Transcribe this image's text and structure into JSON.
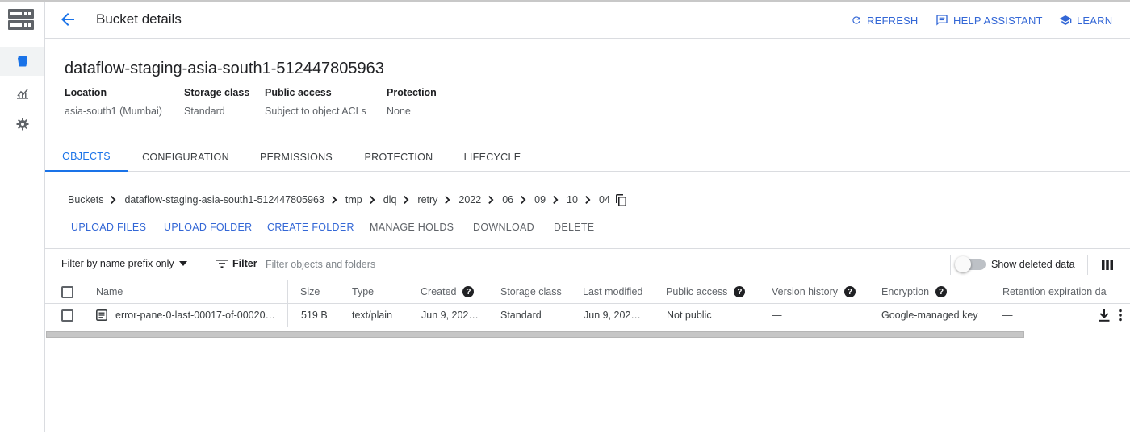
{
  "header": {
    "title": "Bucket details",
    "refresh": "REFRESH",
    "help_assistant": "HELP ASSISTANT",
    "learn": "LEARN"
  },
  "bucket": {
    "name": "dataflow-staging-asia-south1-512447805963",
    "meta": [
      {
        "label": "Location",
        "value": "asia-south1 (Mumbai)"
      },
      {
        "label": "Storage class",
        "value": "Standard"
      },
      {
        "label": "Public access",
        "value": "Subject to object ACLs"
      },
      {
        "label": "Protection",
        "value": "None"
      }
    ]
  },
  "tabs": [
    "OBJECTS",
    "CONFIGURATION",
    "PERMISSIONS",
    "PROTECTION",
    "LIFECYCLE"
  ],
  "active_tab": "OBJECTS",
  "breadcrumb": [
    "Buckets",
    "dataflow-staging-asia-south1-512447805963",
    "tmp",
    "dlq",
    "retry",
    "2022",
    "06",
    "09",
    "10",
    "04"
  ],
  "actions": [
    {
      "label": "UPLOAD FILES",
      "enabled": true
    },
    {
      "label": "UPLOAD FOLDER",
      "enabled": true
    },
    {
      "label": "CREATE FOLDER",
      "enabled": true
    },
    {
      "label": "MANAGE HOLDS",
      "enabled": false
    },
    {
      "label": "DOWNLOAD",
      "enabled": false
    },
    {
      "label": "DELETE",
      "enabled": false
    }
  ],
  "filter": {
    "select_label": "Filter by name prefix only",
    "filter_label": "Filter",
    "placeholder": "Filter objects and folders",
    "show_deleted_label": "Show deleted data",
    "show_deleted_on": false
  },
  "table": {
    "columns": [
      "Name",
      "Size",
      "Type",
      "Created",
      "Storage class",
      "Last modified",
      "Public access",
      "Version history",
      "Encryption",
      "Retention expiration da"
    ],
    "rows": [
      {
        "name": "error-pane-0-last-00017-of-00020…",
        "size": "519 B",
        "type": "text/plain",
        "created": "Jun 9, 202…",
        "storage_class": "Standard",
        "last_modified": "Jun 9, 202…",
        "public_access": "Not public",
        "version_history": "—",
        "encryption": "Google-managed key",
        "retention": "—"
      }
    ]
  },
  "colors": {
    "accent": "#1a73e8",
    "action_blue": "#3367d6",
    "border": "#dadce0",
    "muted_text": "#5f6368"
  }
}
